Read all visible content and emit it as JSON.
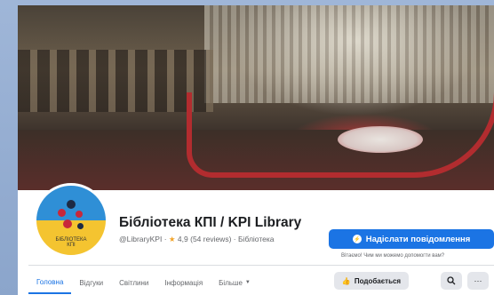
{
  "page": {
    "name": "Бібліотека КПІ / KPI Library",
    "handle": "@LibraryKPI",
    "separator": "·",
    "rating": "4,9",
    "reviews": "(54 reviews)",
    "category": "Бібліотека",
    "avatar_text": "БІБЛІОТЕКА\nКПІ"
  },
  "actions": {
    "message_label": "Надіслати повідомлення",
    "message_hint": "Вітаємо! Чим ми можемо допомогти вам?",
    "like_label": "Подобається",
    "search_icon": "search-icon",
    "more_icon": "more-icon"
  },
  "tabs": [
    {
      "label": "Головна",
      "active": true
    },
    {
      "label": "Відгуки",
      "active": false
    },
    {
      "label": "Світлини",
      "active": false
    },
    {
      "label": "Інформація",
      "active": false
    },
    {
      "label": "Більше",
      "active": false
    }
  ],
  "colors": {
    "accent": "#1b74e4",
    "star": "#f2a42a",
    "avatar_top": "#2f8fd6",
    "avatar_bottom": "#f4c430"
  }
}
